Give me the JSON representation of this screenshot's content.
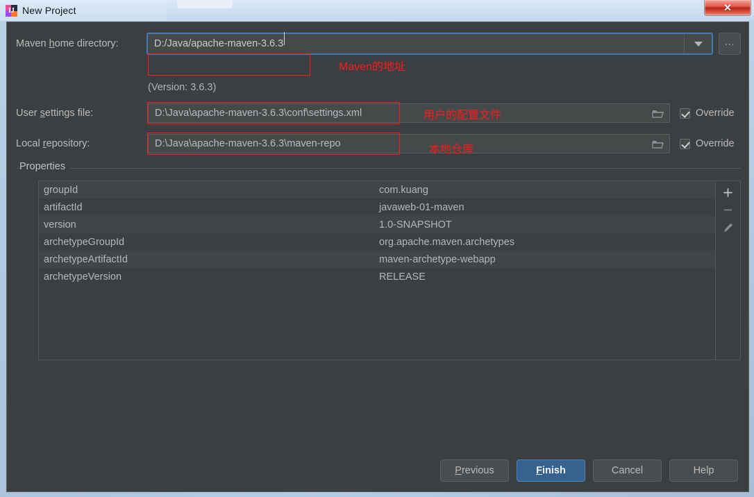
{
  "window": {
    "title": "New Project",
    "app_icon": "intellij-idea-icon",
    "close_label": "✕"
  },
  "form": {
    "maven_home": {
      "label_pre": "Maven ",
      "label_mnemonic": "h",
      "label_post": "ome directory:",
      "value": "D:/Java/apache-maven-3.6.3",
      "browse_label": "...",
      "version_text": "(Version: 3.6.3)"
    },
    "user_settings": {
      "label_pre": "User ",
      "label_mnemonic": "s",
      "label_post": "ettings file:",
      "value": "D:\\Java\\apache-maven-3.6.3\\conf\\settings.xml",
      "override_label": "Override",
      "override_checked": true
    },
    "local_repository": {
      "label_pre": "Local ",
      "label_mnemonic": "r",
      "label_post": "epository:",
      "value": "D:\\Java\\apache-maven-3.6.3\\maven-repo",
      "override_label": "Override",
      "override_checked": true
    }
  },
  "properties": {
    "group_title": "Properties",
    "rows": [
      {
        "key": "groupId",
        "value": "com.kuang"
      },
      {
        "key": "artifactId",
        "value": "javaweb-01-maven"
      },
      {
        "key": "version",
        "value": "1.0-SNAPSHOT"
      },
      {
        "key": "archetypeGroupId",
        "value": "org.apache.maven.archetypes"
      },
      {
        "key": "archetypeArtifactId",
        "value": "maven-archetype-webapp"
      },
      {
        "key": "archetypeVersion",
        "value": "RELEASE"
      }
    ],
    "toolbar": {
      "add": "add-icon",
      "remove": "remove-icon",
      "edit": "edit-pencil-icon"
    }
  },
  "buttons": {
    "previous": {
      "pre": "",
      "mnemonic": "P",
      "post": "revious"
    },
    "finish": {
      "pre": "",
      "mnemonic": "F",
      "post": "inish"
    },
    "cancel": {
      "label": "Cancel"
    },
    "help": {
      "label": "Help"
    }
  },
  "annotations": {
    "maven_home": "Maven的地址",
    "user_settings": "用户的配置文件",
    "local_repository": "本地仓库"
  },
  "colors": {
    "dialog_bg": "#3c3f41",
    "accent_blue": "#3e7bb8",
    "annotation_red": "#fb1b1b",
    "primary_button": "#37628f"
  }
}
